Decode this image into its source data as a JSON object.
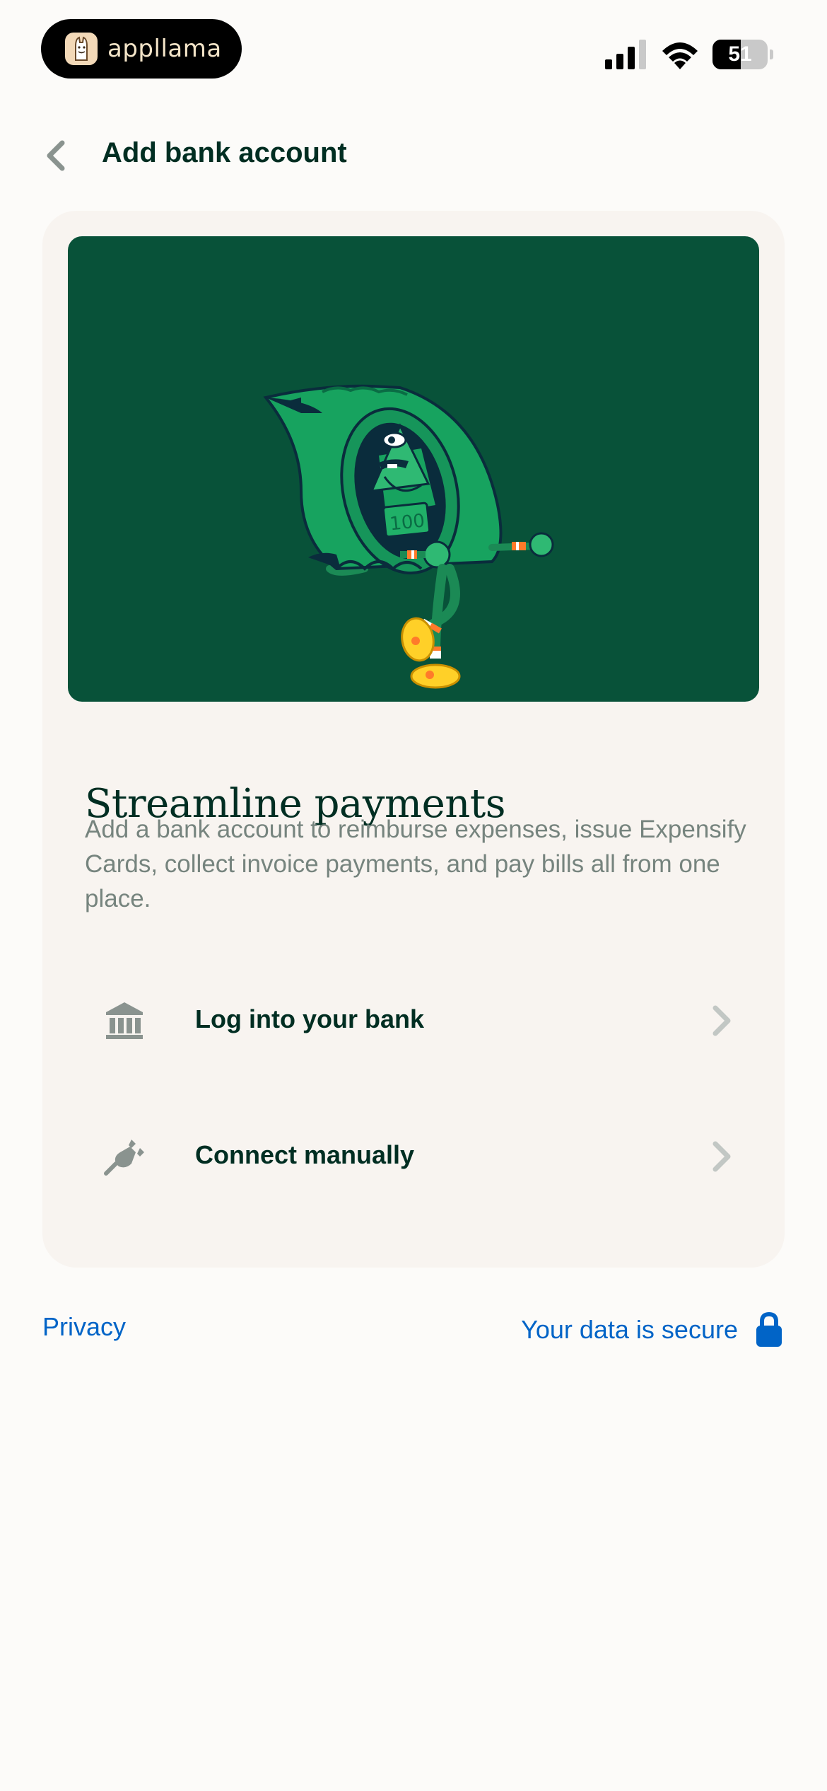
{
  "status_bar": {
    "app_name": "appllama",
    "battery_level": "51",
    "icons": [
      "cellular-signal-icon",
      "wifi-icon",
      "battery-icon"
    ]
  },
  "header": {
    "title": "Add bank account",
    "back_icon": "chevron-left-icon"
  },
  "card": {
    "title": "Streamline payments",
    "description": "Add a bank account to reimburse expenses, issue Expensify Cards, collect invoice payments, and pay bills all from one place.",
    "illustration_text": "100",
    "options": [
      {
        "label": "Log into your bank",
        "icon": "bank-icon"
      },
      {
        "label": "Connect manually",
        "icon": "plug-icon"
      }
    ]
  },
  "footer": {
    "privacy_label": "Privacy",
    "secure_label": "Your data is secure",
    "secure_icon": "lock-icon"
  },
  "colors": {
    "background": "#fcfbf9",
    "card": "#f8f4f0",
    "illustration_bg": "#085239",
    "text_dark": "#002e22",
    "text_muted": "#76847e",
    "link": "#0164c7"
  }
}
